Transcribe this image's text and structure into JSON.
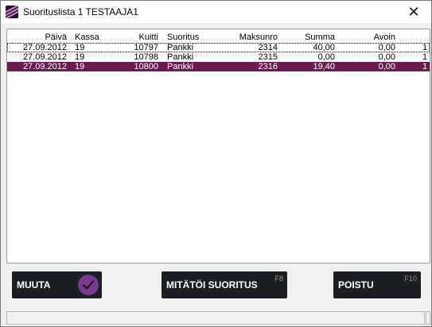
{
  "window": {
    "title": "Suorituslista 1 TESTAAJA1",
    "close_glyph": "✕"
  },
  "table": {
    "headers": [
      "Päivä",
      "Kassa",
      "Kuitti",
      "Suoritus",
      "Maksunro",
      "Summa",
      "Avoin"
    ],
    "rows": [
      [
        "27.09.2012",
        "19",
        "10797",
        "Pankki",
        "2314",
        "40,00",
        "0,00",
        "1"
      ],
      [
        "27.09.2012",
        "19",
        "10798",
        "Pankki",
        "2315",
        "0,00",
        "0,00",
        "1"
      ],
      [
        "27.09.2012",
        "19",
        "10800",
        "Pankki",
        "2316",
        "19,40",
        "0,00",
        "1"
      ]
    ]
  },
  "buttons": {
    "muuta": {
      "label": "MUUTA"
    },
    "mitatoi": {
      "label": "MITÄTÖI SUORITUS",
      "fkey": "F8"
    },
    "poistu": {
      "label": "POISTU",
      "fkey": "F10"
    }
  },
  "colors": {
    "selected_row": "#6b1b4f",
    "button_bg": "#1b1e23",
    "check_accent": "#7a3b8f"
  },
  "icons": {
    "app": "app-logo-icon",
    "close": "close-icon",
    "check": "checkmark-icon"
  }
}
